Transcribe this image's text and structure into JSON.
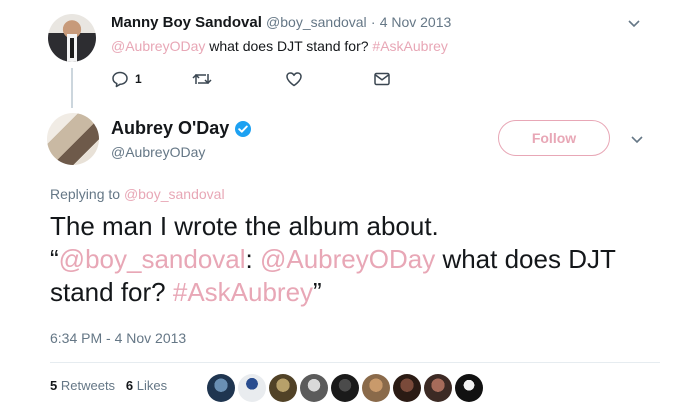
{
  "parent": {
    "name": "Manny Boy Sandoval",
    "handle": "@boy_sandoval",
    "separator": "·",
    "date": "4 Nov 2013",
    "mention": "@AubreyODay",
    "text": " what does DJT stand for? ",
    "hashtag": "#AskAubrey",
    "reply_count": "1",
    "icons": [
      "reply-icon",
      "retweet-icon",
      "like-icon",
      "message-icon"
    ]
  },
  "tweet": {
    "name": "Aubrey O'Day",
    "handle": "@AubreyODay",
    "follow_label": "Follow",
    "replying_prefix": "Replying to",
    "replying_handle": "@boy_sandoval",
    "line1": "The man I wrote the album about.",
    "quote_open": "“",
    "quote_mention1": "@boy_sandoval",
    "quote_colon": ": ",
    "quote_mention2": "@AubreyODay",
    "quote_text": " what does DJT stand for? ",
    "quote_hashtag": "#AskAubrey",
    "quote_close": "”",
    "timestamp": "6:34 PM - 4 Nov 2013"
  },
  "stats": {
    "retweets_count": "5",
    "retweets_label": "Retweets",
    "likes_count": "6",
    "likes_label": "Likes"
  },
  "colors": {
    "link": "#e8a7b6",
    "verified": "#1da1f2",
    "muted": "#657786"
  }
}
